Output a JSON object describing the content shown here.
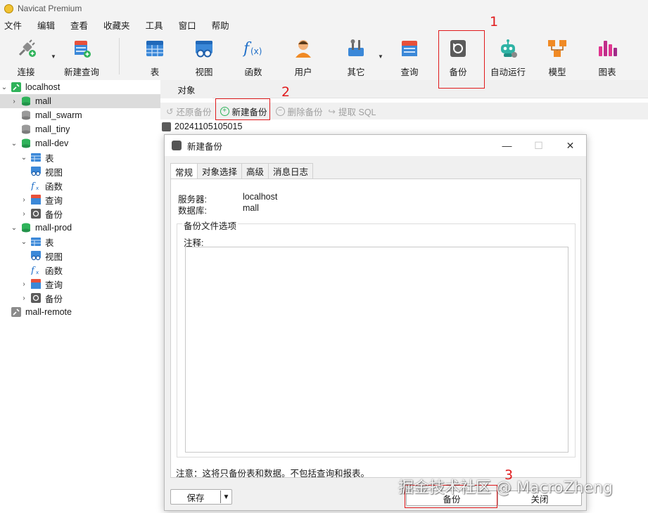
{
  "window": {
    "title": "Navicat Premium"
  },
  "menu": [
    "文件",
    "编辑",
    "查看",
    "收藏夹",
    "工具",
    "窗口",
    "帮助"
  ],
  "toolbar": [
    {
      "label": "连接",
      "icon": "plug-icon"
    },
    {
      "label": "新建查询",
      "icon": "new-query-icon"
    },
    {
      "label": "表",
      "icon": "table-icon"
    },
    {
      "label": "视图",
      "icon": "view-icon"
    },
    {
      "label": "函数",
      "icon": "function-icon"
    },
    {
      "label": "用户",
      "icon": "user-icon"
    },
    {
      "label": "其它",
      "icon": "tools-icon"
    },
    {
      "label": "查询",
      "icon": "query-icon"
    },
    {
      "label": "备份",
      "icon": "backup-icon"
    },
    {
      "label": "自动运行",
      "icon": "robot-icon"
    },
    {
      "label": "模型",
      "icon": "model-icon"
    },
    {
      "label": "图表",
      "icon": "chart-icon"
    }
  ],
  "tree": [
    {
      "label": "localhost",
      "type": "connection"
    },
    {
      "label": "mall",
      "type": "database"
    },
    {
      "label": "mall_swarm",
      "type": "database-inactive"
    },
    {
      "label": "mall_tiny",
      "type": "database-inactive"
    },
    {
      "label": "mall-dev",
      "type": "database"
    },
    {
      "label": "表",
      "type": "table"
    },
    {
      "label": "视图",
      "type": "view"
    },
    {
      "label": "函数",
      "type": "function"
    },
    {
      "label": "查询",
      "type": "query"
    },
    {
      "label": "备份",
      "type": "backup"
    },
    {
      "label": "mall-prod",
      "type": "database"
    },
    {
      "label": "表",
      "type": "table"
    },
    {
      "label": "视图",
      "type": "view"
    },
    {
      "label": "函数",
      "type": "function"
    },
    {
      "label": "查询",
      "type": "query"
    },
    {
      "label": "备份",
      "type": "backup"
    },
    {
      "label": "mall-remote",
      "type": "connection-inactive"
    }
  ],
  "objects": {
    "tab_label": "对象",
    "toolbar": {
      "restore": "还原备份",
      "new_backup": "新建备份",
      "delete_backup": "删除备份",
      "extract_sql": "提取 SQL"
    },
    "backup_item": "20241105105015"
  },
  "dialog": {
    "title": "新建备份",
    "tabs": [
      "常规",
      "对象选择",
      "高级",
      "消息日志"
    ],
    "server_label": "服务器:",
    "server_value": "localhost",
    "database_label": "数据库:",
    "database_value": "mall",
    "group_title": "备份文件选项",
    "comment_label": "注释:",
    "comment_value": "",
    "note": "注意：这将只备份表和数据。不包括查询和报表。",
    "save_label": "保存",
    "backup_label": "备份",
    "close_label": "关闭"
  },
  "annotations": [
    "1",
    "2",
    "3"
  ],
  "watermark": "掘金技术社区 @ MacroZheng",
  "colors": {
    "annotation": "#e0191b",
    "selected_row": "#dcdcdc",
    "db_green": "#2fb35a",
    "panel_bg": "#f0f0f0"
  }
}
